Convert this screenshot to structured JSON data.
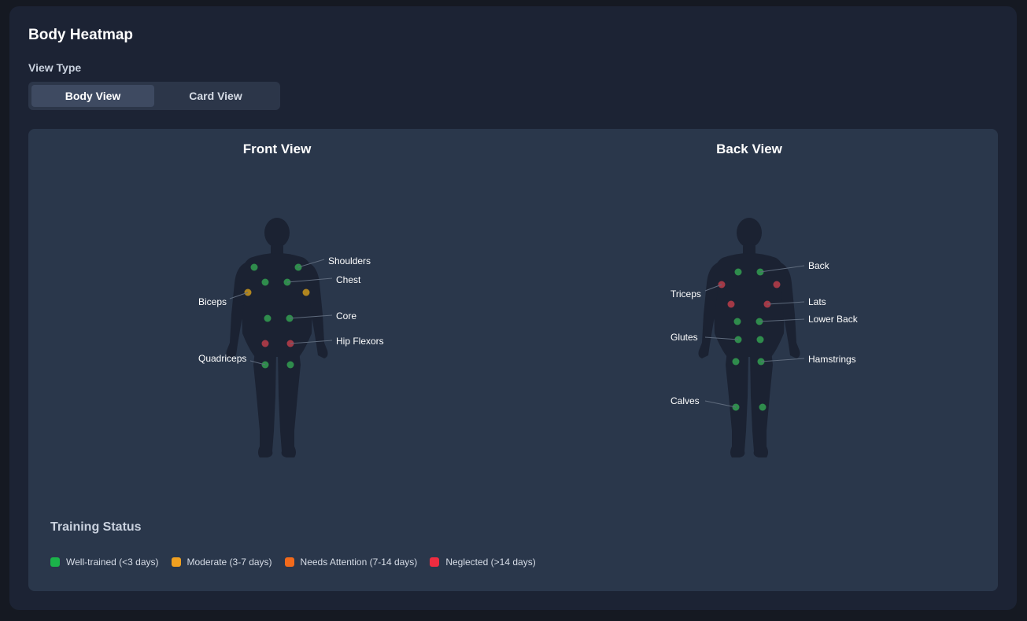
{
  "header": {
    "title": "Body Heatmap",
    "view_type_label": "View Type"
  },
  "toggle": {
    "options": [
      "Body View",
      "Card View"
    ],
    "active": "Body View"
  },
  "front": {
    "title": "Front View",
    "labels": [
      "Shoulders",
      "Chest",
      "Biceps",
      "Core",
      "Hip Flexors",
      "Quadriceps"
    ]
  },
  "back": {
    "title": "Back View",
    "labels": [
      "Back",
      "Triceps",
      "Lats",
      "Lower Back",
      "Glutes",
      "Hamstrings",
      "Calves"
    ]
  },
  "muscle_status": {
    "Shoulders": "well",
    "Chest": "well",
    "Biceps": "moderate",
    "Core": "well",
    "Hip Flexors": "neglected",
    "Quadriceps": "well",
    "Back": "well",
    "Triceps": "neglected",
    "Lats": "neglected",
    "Lower Back": "well",
    "Glutes": "well",
    "Hamstrings": "well",
    "Calves": "well"
  },
  "legend": {
    "title": "Training Status",
    "items": [
      {
        "label": "Well-trained (<3 days)",
        "color": "#1bb34a"
      },
      {
        "label": "Moderate (3-7 days)",
        "color": "#f0a020"
      },
      {
        "label": "Needs Attention (7-14 days)",
        "color": "#f26a1b"
      },
      {
        "label": "Neglected (>14 days)",
        "color": "#ee2c40"
      }
    ]
  },
  "colors": {
    "well": "#2f8c4c",
    "moderate": "#b0851f",
    "attention": "#b96025",
    "neglected": "#a33946",
    "silhouette": "#1b2232",
    "leader": "#5f6b7d"
  }
}
